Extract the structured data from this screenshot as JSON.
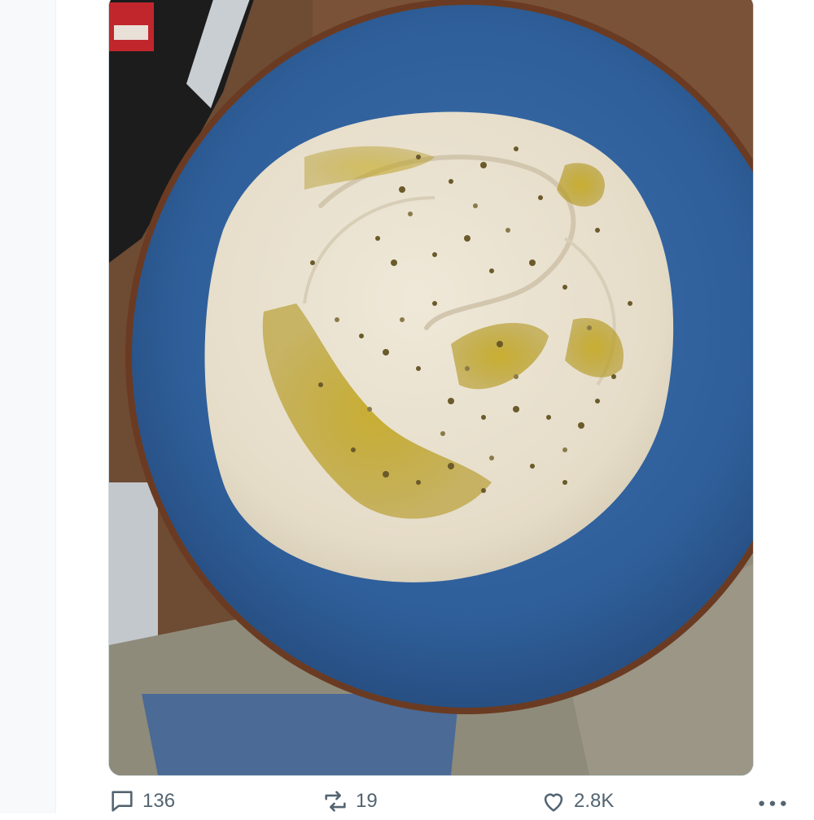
{
  "tweet": {
    "media": {
      "icon": "photo-hummus-plate"
    },
    "actions": {
      "reply_count": "136",
      "retweet_count": "19",
      "like_count": "2.8K"
    }
  },
  "colors": {
    "icon_gray": "#536471",
    "plate_blue": "#2f5f9a",
    "hummus": "#e8e0cf",
    "olive_oil": "#b59a1f"
  }
}
